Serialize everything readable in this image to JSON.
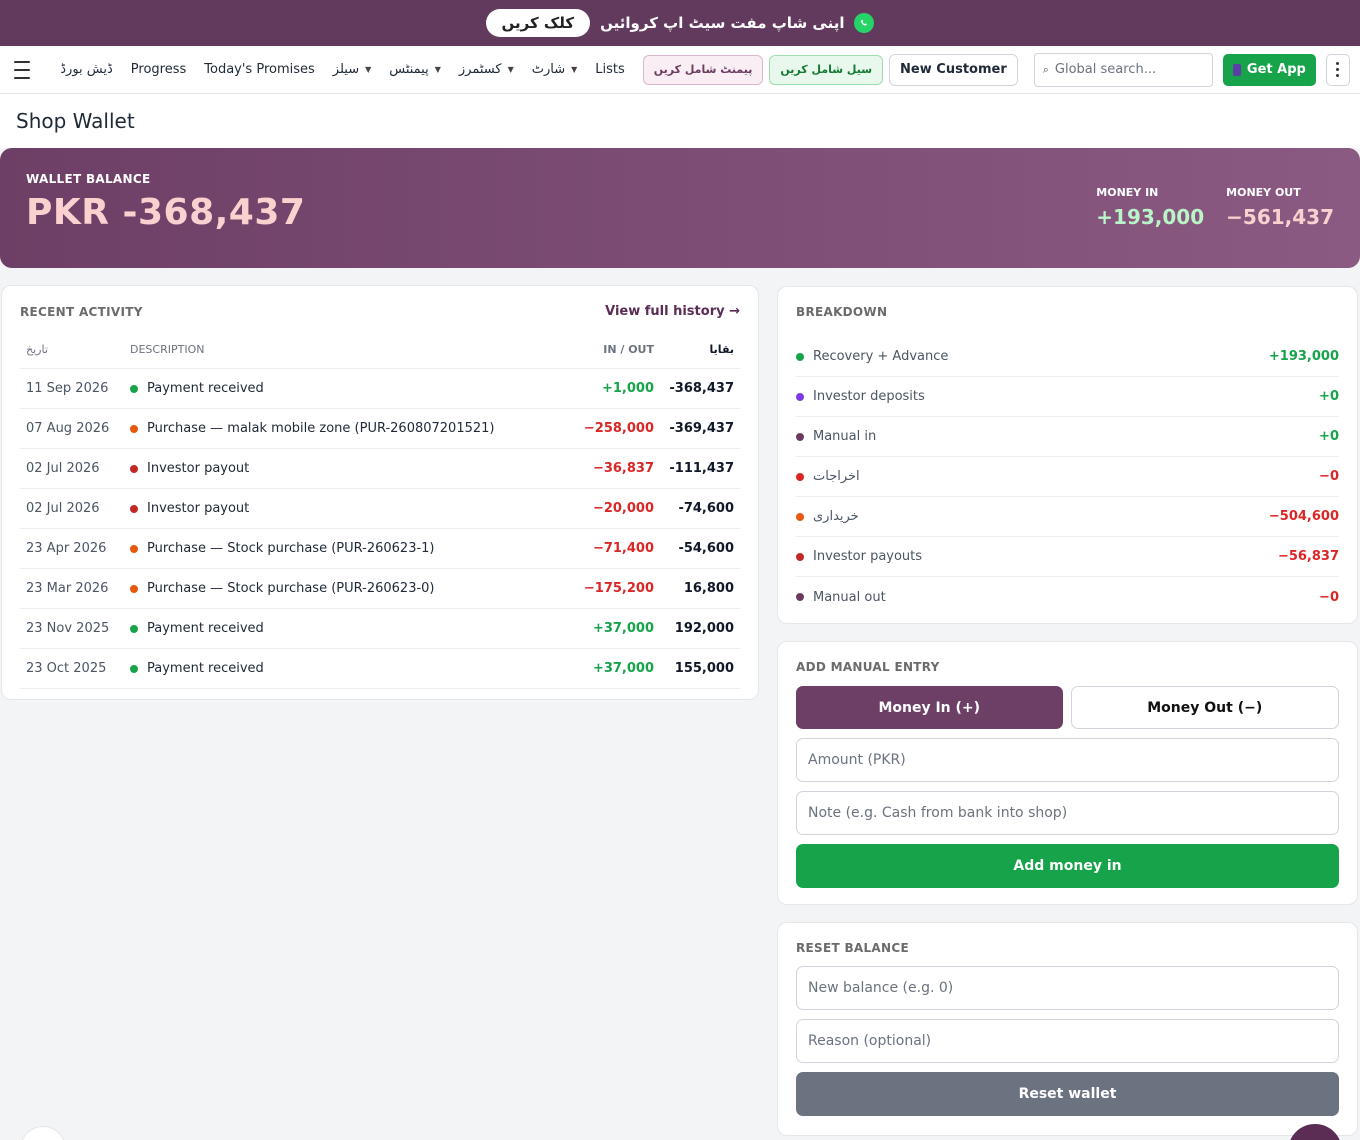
{
  "promo": {
    "cta": "کلک کریں",
    "text": "اپنی شاپ مفت سیٹ اپ کروائیں"
  },
  "nav": {
    "dashboard": "ڈیش بورڈ",
    "progress": "Progress",
    "promises": "Today's Promises",
    "sales": "سیلز",
    "payments": "پیمنٹس",
    "customers": "کسٹمرز",
    "chart": "شارٹ",
    "lists": "Lists",
    "add_payment": "پیمنٹ شامل کریں",
    "add_sale": "سیل شامل کریں",
    "new_customer": "New Customer",
    "search_placeholder": "Global search...",
    "get_app": "Get App"
  },
  "page": {
    "title": "Shop Wallet"
  },
  "wallet": {
    "balance_label": "WALLET BALANCE",
    "balance": "PKR -368,437",
    "money_in_label": "MONEY IN",
    "money_in": "+193,000",
    "money_out_label": "MONEY OUT",
    "money_out": "−561,437"
  },
  "recent": {
    "title": "RECENT ACTIVITY",
    "view_history": "View full history →",
    "headers": {
      "date": "تاریخ",
      "desc": "DESCRIPTION",
      "io": "IN / OUT",
      "balance": "بقایا"
    },
    "rows": [
      {
        "date": "11 Sep 2026",
        "desc": "Payment received",
        "io": "+1,000",
        "balance": "-368,437"
      },
      {
        "date": "07 Aug 2026",
        "desc": "Purchase — malak mobile zone (PUR-260807201521)",
        "io": "−258,000",
        "balance": "-369,437"
      },
      {
        "date": "02 Jul 2026",
        "desc": "Investor payout",
        "io": "−36,837",
        "balance": "-111,437"
      },
      {
        "date": "02 Jul 2026",
        "desc": "Investor payout",
        "io": "−20,000",
        "balance": "-74,600"
      },
      {
        "date": "23 Apr 2026",
        "desc": "Purchase — Stock purchase (PUR-260623-1)",
        "io": "−71,400",
        "balance": "-54,600"
      },
      {
        "date": "23 Mar 2026",
        "desc": "Purchase — Stock purchase (PUR-260623-0)",
        "io": "−175,200",
        "balance": "16,800"
      },
      {
        "date": "23 Nov 2025",
        "desc": "Payment received",
        "io": "+37,000",
        "balance": "192,000"
      },
      {
        "date": "23 Oct 2025",
        "desc": "Payment received",
        "io": "+37,000",
        "balance": "155,000"
      }
    ]
  },
  "breakdown": {
    "title": "BREAKDOWN",
    "items": [
      {
        "label": "Recovery + Advance",
        "value": "+193,000"
      },
      {
        "label": "Investor deposits",
        "value": "+0"
      },
      {
        "label": "Manual in",
        "value": "+0"
      },
      {
        "label": "اخراجات",
        "value": "−0"
      },
      {
        "label": "خریداری",
        "value": "−504,600"
      },
      {
        "label": "Investor payouts",
        "value": "−56,837"
      },
      {
        "label": "Manual out",
        "value": "−0"
      }
    ]
  },
  "manual_entry": {
    "title": "ADD MANUAL ENTRY",
    "money_in_tab": "Money In (+)",
    "money_out_tab": "Money Out (−)",
    "amount_placeholder": "Amount (PKR)",
    "note_placeholder": "Note (e.g. Cash from bank into shop)",
    "submit": "Add money in"
  },
  "reset": {
    "title": "RESET BALANCE",
    "balance_placeholder": "New balance (e.g. 0)",
    "reason_placeholder": "Reason (optional)",
    "submit": "Reset wallet"
  },
  "colors": {
    "brand": "#6e3f66",
    "positive": "#16a34a",
    "negative": "#dc2626",
    "dot_green": "#16a34a",
    "dot_orange": "#ea580c",
    "dot_red": "#c62828",
    "dot_purple": "#7c3aed",
    "dot_plum": "#6b3c5f"
  }
}
